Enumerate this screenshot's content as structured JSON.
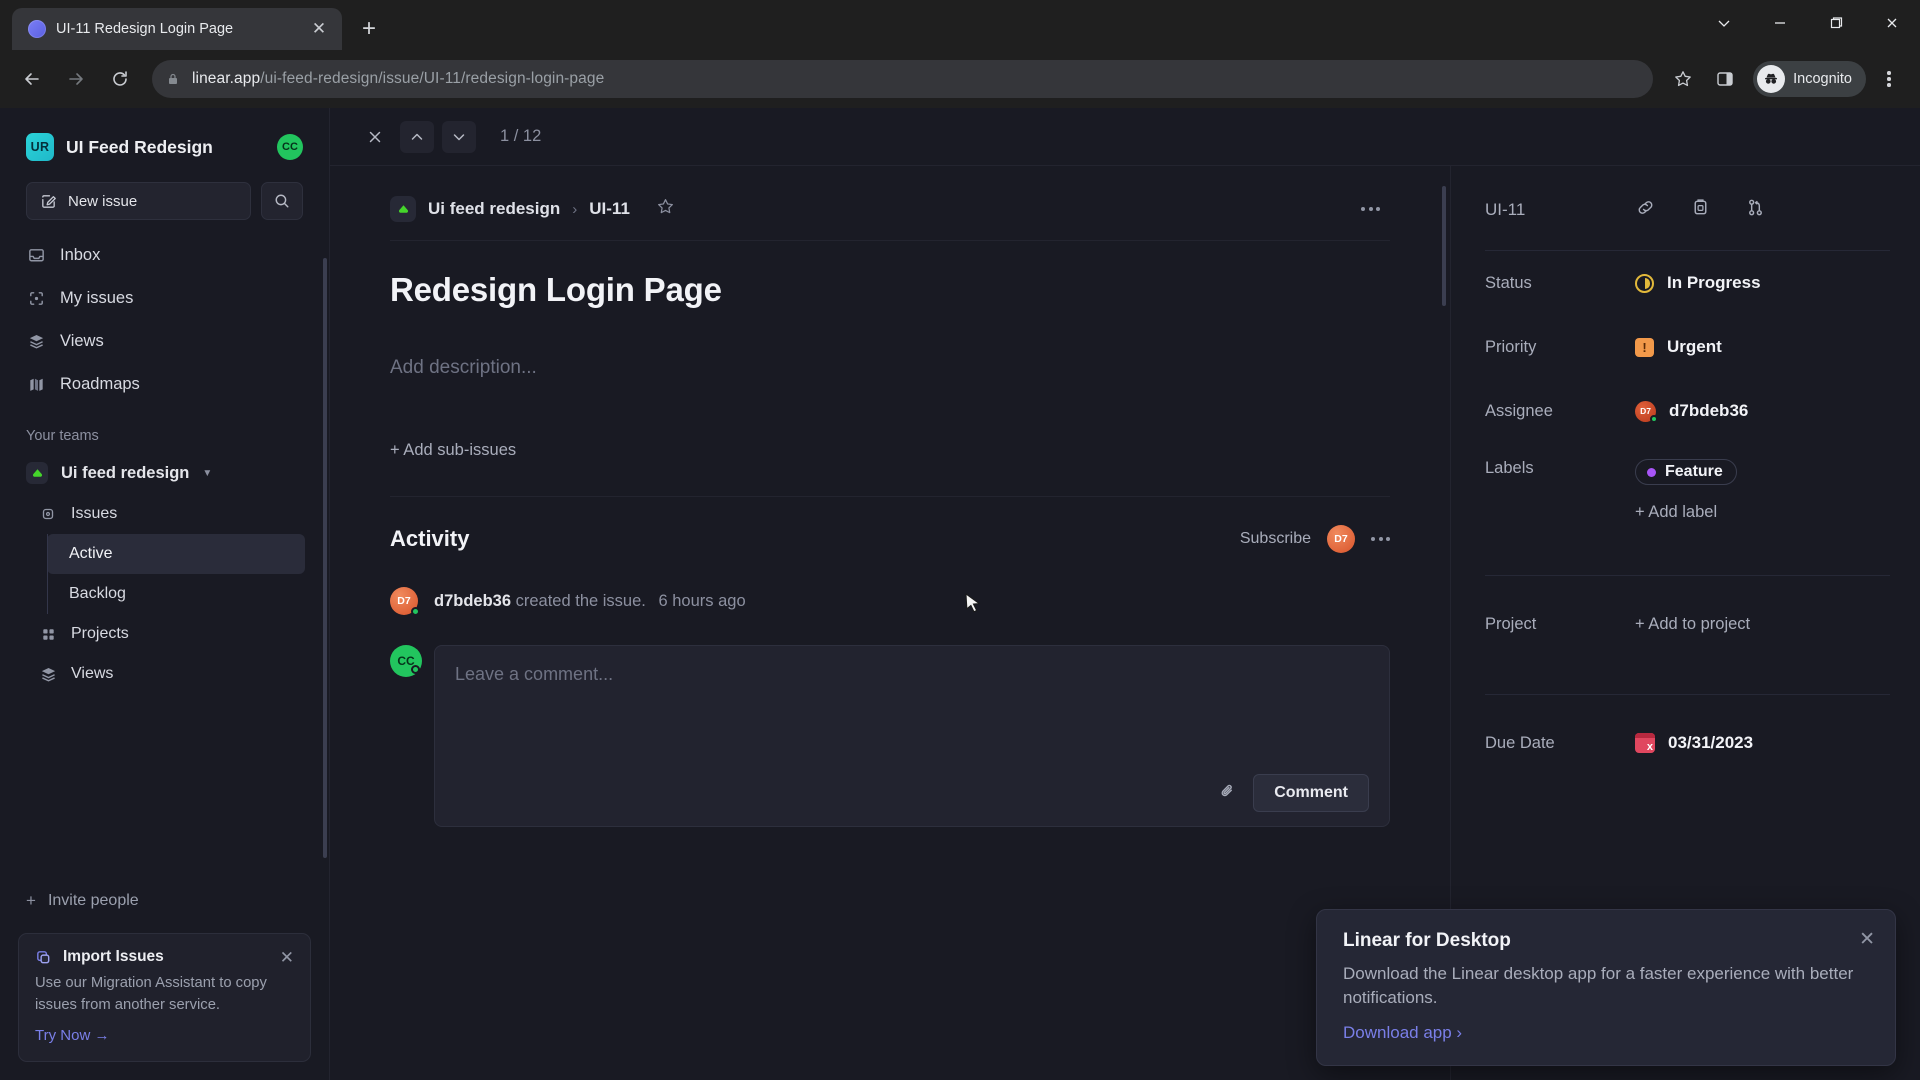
{
  "browser": {
    "tab_title": "UI-11 Redesign Login Page",
    "tab_close_label": "✕",
    "new_tab_label": "+",
    "url_domain": "linear.app",
    "url_path": "/ui-feed-redesign/issue/UI-11/redesign-login-page",
    "profile_label": "Incognito",
    "window": {
      "minimize": "—",
      "maximize": "❐",
      "close": "✕",
      "tab_search": "⌄"
    }
  },
  "sidebar": {
    "workspace_name": "UI Feed Redesign",
    "workspace_initials": "UR",
    "user_initials": "CC",
    "new_issue_label": "New issue",
    "nav": [
      {
        "label": "Inbox",
        "icon": "inbox-icon"
      },
      {
        "label": "My issues",
        "icon": "my-issues-icon"
      },
      {
        "label": "Views",
        "icon": "views-icon"
      },
      {
        "label": "Roadmaps",
        "icon": "roadmaps-icon"
      }
    ],
    "teams_section_label": "Your teams",
    "team_name": "Ui feed redesign",
    "team_children": [
      {
        "label": "Issues",
        "icon": "issues-icon"
      }
    ],
    "issue_views": [
      {
        "label": "Active",
        "active": true
      },
      {
        "label": "Backlog",
        "active": false
      }
    ],
    "team_children_rest": [
      {
        "label": "Projects",
        "icon": "projects-icon"
      },
      {
        "label": "Views",
        "icon": "views-icon"
      }
    ],
    "invite_label": "Invite people",
    "import_card": {
      "title": "Import Issues",
      "body": "Use our Migration Assistant to copy issues from another service.",
      "link": "Try Now →",
      "close": "✕"
    }
  },
  "main": {
    "close_label": "✕",
    "counter": "1 / 12",
    "breadcrumb": {
      "team": "Ui feed redesign",
      "separator": "›",
      "issue_id": "UI-11"
    },
    "issue_title": "Redesign Login Page",
    "description_placeholder": "Add description...",
    "add_sub_issues": "+ Add sub-issues",
    "activity": {
      "title": "Activity",
      "subscribe_label": "Subscribe",
      "subscriber_initials": "D7",
      "entry_user": "d7bdeb36",
      "entry_action": "created the issue.",
      "entry_time": "6 hours ago",
      "entry_initials": "D7"
    },
    "comment": {
      "author_initials": "CC",
      "placeholder": "Leave a comment...",
      "submit_label": "Comment"
    }
  },
  "properties": {
    "issue_id": "UI-11",
    "icons": [
      "link-icon",
      "copy-icon",
      "branch-icon"
    ],
    "rows": [
      {
        "label": "Status",
        "value": "In Progress",
        "icon": "status-in-progress-icon",
        "color": "#e2b93b"
      },
      {
        "label": "Priority",
        "value": "Urgent",
        "icon": "priority-urgent-icon",
        "color": "#f2994a"
      },
      {
        "label": "Assignee",
        "value": "d7bdeb36",
        "icon": "avatar",
        "initials": "D7"
      }
    ],
    "labels": {
      "label": "Labels",
      "chips": [
        {
          "text": "Feature",
          "color": "#a855f7"
        }
      ],
      "add_label": "+ Add label"
    },
    "project": {
      "label": "Project",
      "value": "+ Add to project"
    },
    "due_date": {
      "label": "Due Date",
      "value": "03/31/2023",
      "icon": "calendar-icon",
      "color": "#e0475f"
    }
  },
  "toast": {
    "title": "Linear for Desktop",
    "body": "Download the Linear desktop app for a faster experience with better notifications.",
    "link": "Download app ›",
    "close": "✕"
  }
}
